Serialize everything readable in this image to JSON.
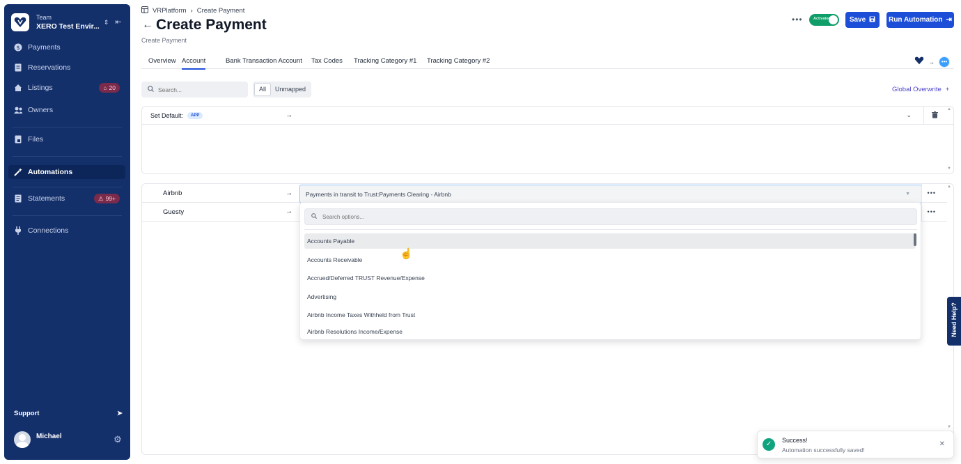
{
  "sidebar": {
    "team_label": "Team",
    "team_name": "XERO Test Envir...",
    "items": [
      {
        "label": "Payments",
        "icon": "dollar-icon"
      },
      {
        "label": "Reservations",
        "icon": "document-icon"
      },
      {
        "label": "Listings",
        "icon": "home-icon",
        "badge": "20"
      },
      {
        "label": "Owners",
        "icon": "users-icon"
      },
      {
        "label": "Files",
        "icon": "file-icon"
      },
      {
        "label": "Automations",
        "icon": "wand-icon",
        "active": true
      },
      {
        "label": "Statements",
        "icon": "statement-icon",
        "badge": "99+"
      },
      {
        "label": "Connections",
        "icon": "plug-icon"
      }
    ],
    "support_label": "Support",
    "user_name": "Michael"
  },
  "breadcrumb": {
    "root": "VRPlatform",
    "current": "Create Payment"
  },
  "header": {
    "title": "Create Payment",
    "subtitle": "Create Payment",
    "toggle_label": "Activated",
    "save_label": "Save",
    "run_label": "Run Automation"
  },
  "tabs": [
    "Overview",
    "Account",
    "Bank Transaction Account",
    "Tax Codes",
    "Tracking Category #1",
    "Tracking Category #2"
  ],
  "filters": {
    "search_placeholder": "Search...",
    "seg_all": "All",
    "seg_unmapped": "Unmapped",
    "global_overwrite": "Global Overwrite"
  },
  "default_card": {
    "label": "Set Default:",
    "badge": "APP"
  },
  "rows": [
    {
      "label": "Airbnb",
      "value": "Payments in transit to Trust:Payments Clearing - Airbnb"
    },
    {
      "label": "Guesty"
    }
  ],
  "dropdown": {
    "search_placeholder": "Search options...",
    "options": [
      "Accounts Payable",
      "Accounts Receivable",
      "Accrued/Deferred TRUST Revenue/Expense",
      "Advertising",
      "Airbnb Income Taxes Withheld from Trust",
      "Airbnb Resolutions Income/Expense"
    ]
  },
  "need_help": "Need Help?",
  "toast": {
    "title": "Success!",
    "message": "Automation successfully saved!"
  },
  "colors": {
    "sidebar": "#14306b",
    "primary": "#1d4ed8",
    "toggle": "#0f9d6a",
    "badge": "#7a2a4a",
    "success": "#10a37f"
  }
}
